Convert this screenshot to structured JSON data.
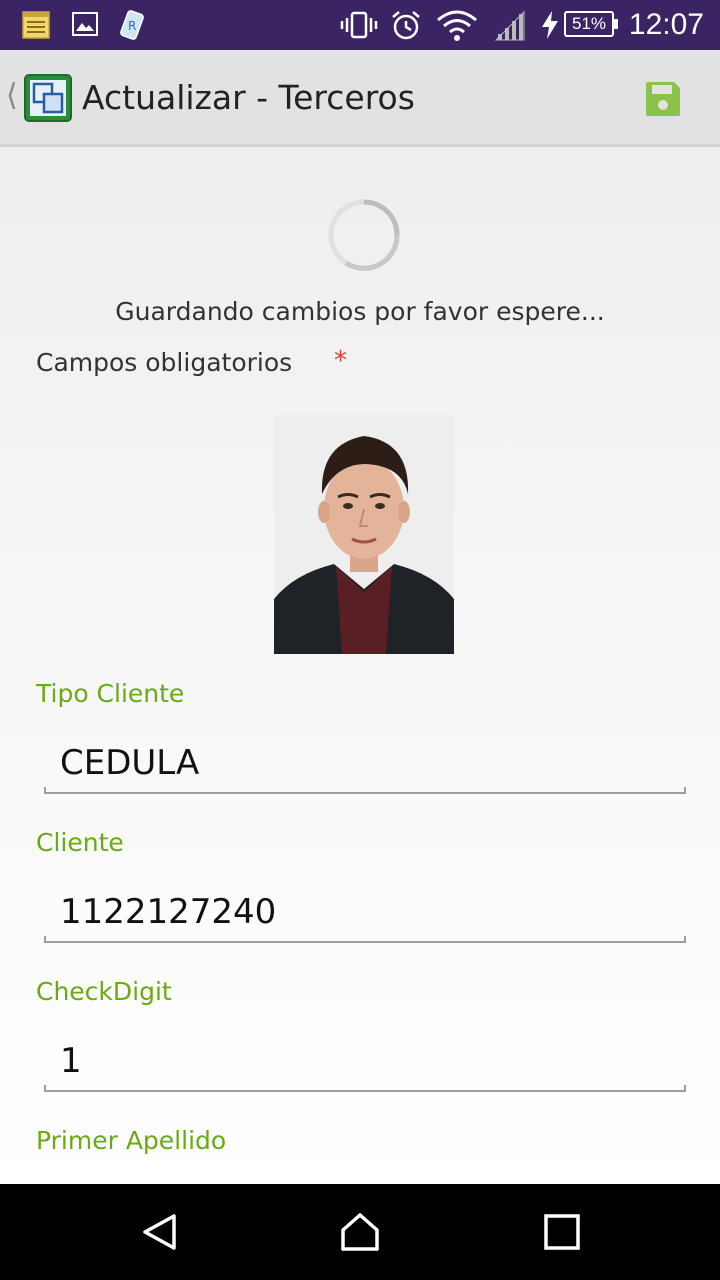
{
  "status_bar": {
    "time": "12:07",
    "battery": "51%",
    "icons": [
      "notes-icon",
      "image-icon",
      "app-icon",
      "vibrate-icon",
      "alarm-icon",
      "wifi-icon",
      "signal-icon",
      "charging-icon"
    ]
  },
  "action_bar": {
    "title": "Actualizar - Terceros",
    "accent_color": "#8bc34a"
  },
  "status": {
    "saving_message": "Guardando cambios por favor espere..."
  },
  "form": {
    "required_label": "Campos obligatorios",
    "required_marker": "*",
    "fields": [
      {
        "label": "Tipo Cliente",
        "value": "CEDULA"
      },
      {
        "label": "Cliente",
        "value": "1122127240"
      },
      {
        "label": "CheckDigit",
        "value": "1"
      },
      {
        "label": "Primer Apellido",
        "value": ""
      }
    ]
  },
  "colors": {
    "status_bar": "#3b2464",
    "label_green": "#6aaa12",
    "required_red": "#e53935"
  }
}
